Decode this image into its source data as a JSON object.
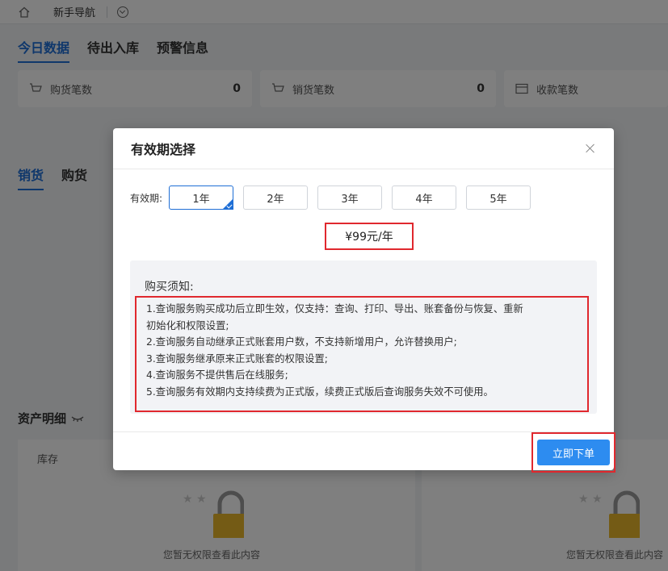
{
  "topbar": {
    "nav_label": "新手导航"
  },
  "data_tabs": [
    {
      "label": "今日数据",
      "active": true
    },
    {
      "label": "待出入库",
      "active": false
    },
    {
      "label": "预警信息",
      "active": false
    }
  ],
  "stats": [
    {
      "label": "购货笔数",
      "value": "0"
    },
    {
      "label": "销货笔数",
      "value": "0"
    },
    {
      "label": "收款笔数",
      "value": ""
    }
  ],
  "sales_tabs": [
    {
      "label": "销货",
      "active": true
    },
    {
      "label": "购货",
      "active": false
    }
  ],
  "assets": {
    "title": "资产明细",
    "panel_title": "库存",
    "no_permission": "您暂无权限查看此内容"
  },
  "dialog": {
    "title": "有效期选择",
    "period_label": "有效期:",
    "options": [
      "1年",
      "2年",
      "3年",
      "4年",
      "5年"
    ],
    "selected_option": "1年",
    "price": "¥99元/年",
    "notice_title": "购买须知:",
    "notice_lines": [
      "1.查询服务购买成功后立即生效，仅支持：查询、打印、导出、账套备份与恢复、重新",
      "初始化和权限设置;",
      "2.查询服务自动继承正式账套用户数，不支持新增用户，允许替换用户;",
      "3.查询服务继承原来正式账套的权限设置;",
      "4.查询服务不提供售后在线服务;",
      "5.查询服务有效期内支持续费为正式版，续费正式版后查询服务失效不可使用。"
    ],
    "order_button": "立即下单"
  },
  "colors": {
    "primary": "#1f6fd6",
    "button": "#2d8cf0",
    "highlight": "#e0282e",
    "lock": "#e8b62a"
  }
}
